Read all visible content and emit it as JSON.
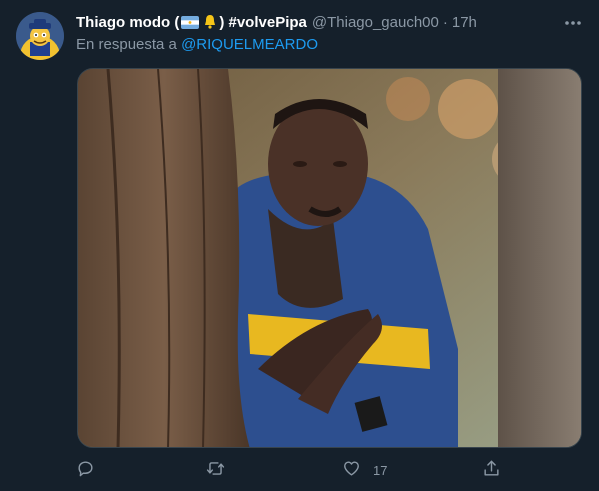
{
  "tweet": {
    "display_name_prefix": "Thiago modo (",
    "display_name_suffix": ") #volvePipa",
    "handle": "@Thiago_gauch00",
    "separator": "·",
    "time": "17h",
    "reply_prefix": "En respuesta a ",
    "reply_to": "@RIQUELMEARDO",
    "likes": "17"
  },
  "icons": {
    "more": "more-dots-icon",
    "reply": "reply-bubble-icon",
    "retweet": "retweet-icon",
    "like": "heart-icon",
    "share": "share-icon"
  },
  "colors": {
    "background": "#15202b",
    "secondary_text": "#8b98a5",
    "link": "#1d9bf0",
    "border": "#38444d"
  }
}
